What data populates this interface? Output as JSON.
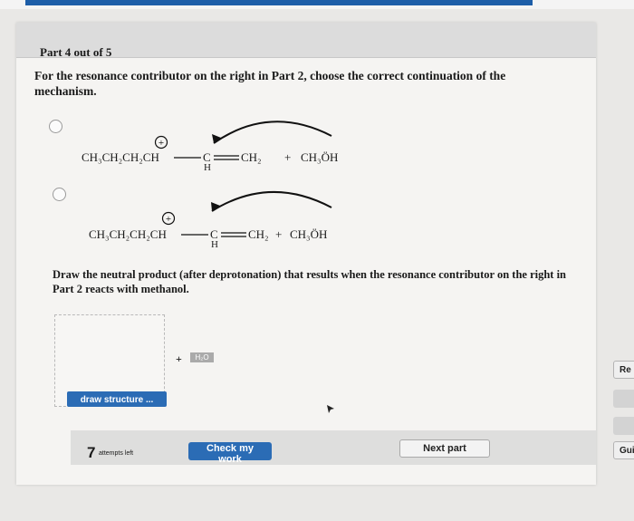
{
  "header": {
    "part_label": "Part 4 out of 5"
  },
  "question": "For the resonance contributor on the right in Part 2, choose the correct continuation of the mechanism.",
  "options": [
    {
      "chain": "CH₃CH₂CH₂CH",
      "charge": "+",
      "carbon": "C",
      "h_below": "H",
      "end_group": "CH₂",
      "plus": "+",
      "methanol": "CH₃ÖH"
    },
    {
      "chain": "CH₃CH₂CH₂CH",
      "charge": "+",
      "carbon": "C",
      "h_below": "H",
      "end_group": "CH₂",
      "plus": "+",
      "methanol": "CH₃ÖH"
    }
  ],
  "draw_prompt": "Draw the neutral product (after deprotonation) that results when the resonance contributor on the right in Part 2 reacts with methanol.",
  "draw": {
    "button_label": "draw structure ...",
    "plus": "+",
    "badge": "H₂O"
  },
  "footer": {
    "attempts_count": "7",
    "attempts_label": "attempts left",
    "check_label": "Check my work",
    "next_label": "Next part"
  },
  "side": {
    "btn1": "Re",
    "btn2": "Gui"
  },
  "colors": {
    "accent": "#2b6cb5",
    "background": "#e9e8e6"
  }
}
